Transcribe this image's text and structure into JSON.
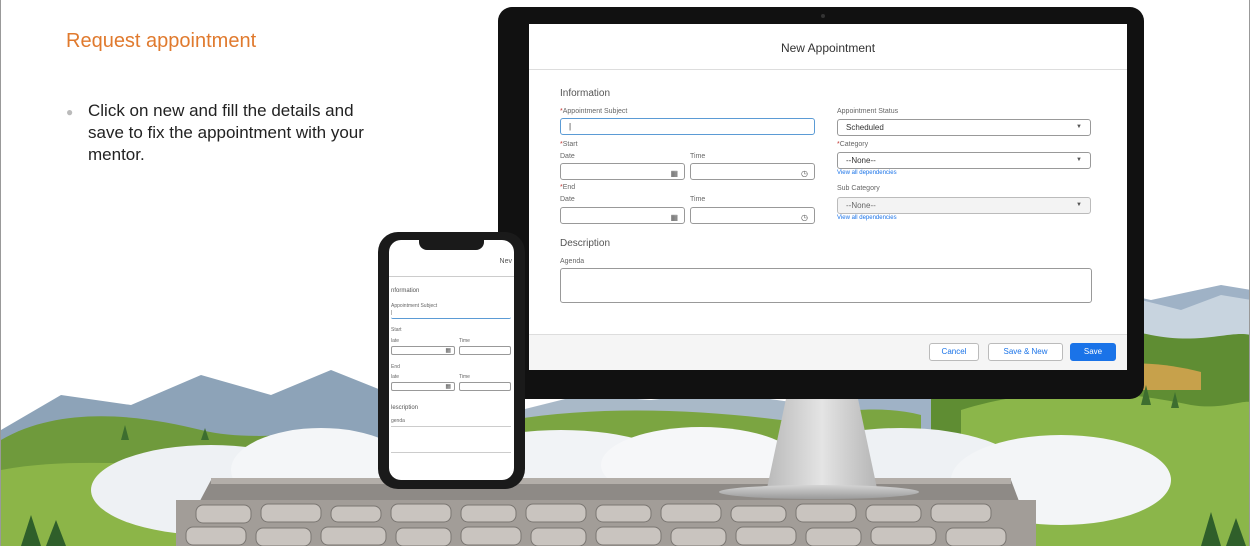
{
  "slide": {
    "title": "Request appointment",
    "bullet": "Click on new and fill the details and save to fix the appointment with your mentor."
  },
  "modal": {
    "title": "New Appointment",
    "information_section": "Information",
    "subject_label": "Appointment Subject",
    "subject_value": "|",
    "status_label": "Appointment Status",
    "status_value": "Scheduled",
    "start_label": "Start",
    "category_label": "Category",
    "category_value": "--None--",
    "date_label": "Date",
    "time_label": "Time",
    "view_dependencies": "View all dependencies",
    "end_label": "End",
    "subcategory_label": "Sub Category",
    "subcategory_value": "--None--",
    "description_section": "Description",
    "agenda_label": "Agenda",
    "buttons": {
      "cancel": "Cancel",
      "save_new": "Save & New",
      "save": "Save"
    }
  },
  "phone": {
    "title": "Nev",
    "information_section": "nformation",
    "subject_label": "Appointment Subject",
    "subject_value": "|",
    "start_label": "Start",
    "date_label": "late",
    "time_label": "Time",
    "end_label": "End",
    "description_section": "lescription",
    "agenda_label": "genda"
  },
  "colors": {
    "title_accent": "#e07a2e",
    "primary_button": "#1a73e8",
    "focus_border": "#5b9bd5"
  }
}
